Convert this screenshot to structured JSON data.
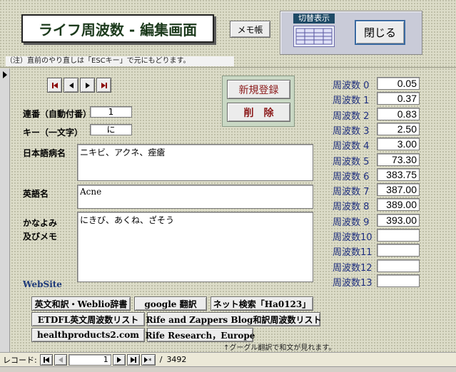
{
  "header": {
    "title": "ライフ周波数 - 編集画面",
    "memo_button": "メモ帳",
    "toggle_label": "切替表示",
    "close_button": "閉じる",
    "note": "（注）直前のやり直しは「ESCキー」で元にもどります。"
  },
  "form": {
    "serial_label": "連番（自動付番）",
    "serial_value": "1",
    "key_label": "キー（一文字）",
    "key_value": "に",
    "jp_name_label": "日本語病名",
    "jp_name_value": "ニキビ、アクネ、痤瘡",
    "en_name_label": "英語名",
    "en_name_value": "Acne",
    "kana_label_1": "かなよみ",
    "kana_label_2": "及びメモ",
    "kana_value": "にきび、あくね、ざそう",
    "website_label": "WebSite"
  },
  "actions": {
    "new_record": "新規登録",
    "delete": "削　除"
  },
  "frequencies": [
    {
      "label": "周波数 0",
      "value": "0.05"
    },
    {
      "label": "周波数 1",
      "value": "0.37"
    },
    {
      "label": "周波数 2",
      "value": "0.83"
    },
    {
      "label": "周波数 3",
      "value": "2.50"
    },
    {
      "label": "周波数 4",
      "value": "3.00"
    },
    {
      "label": "周波数 5",
      "value": "73.30"
    },
    {
      "label": "周波数 6",
      "value": "383.75"
    },
    {
      "label": "周波数 7",
      "value": "387.00"
    },
    {
      "label": "周波数 8",
      "value": "389.00"
    },
    {
      "label": "周波数 9",
      "value": "393.00"
    },
    {
      "label": "周波数10",
      "value": ""
    },
    {
      "label": "周波数11",
      "value": ""
    },
    {
      "label": "周波数12",
      "value": ""
    },
    {
      "label": "周波数13",
      "value": ""
    }
  ],
  "links": {
    "weblio": "英文和訳・Weblio辞書",
    "google": "google 翻訳",
    "net_search": "ネット検索「Ha0123」",
    "etdfl": "ETDFL英文周波数リスト",
    "rife_blog": "Rife and Zappers Blog和訳周波数リスト",
    "healthproducts": "healthproducts2.com",
    "rife_research": "Rife Research，Europe"
  },
  "footer_note": "↑グーグル翻訳で和文が見れます。",
  "record_nav": {
    "label": "レコード:",
    "current": "1",
    "separator": "/",
    "total": "3492"
  },
  "icons": {
    "first": "first-record-icon",
    "prev": "prev-record-icon",
    "next": "next-record-icon",
    "last": "last-record-icon",
    "new": "new-record-icon",
    "selector": "record-selector-icon"
  }
}
